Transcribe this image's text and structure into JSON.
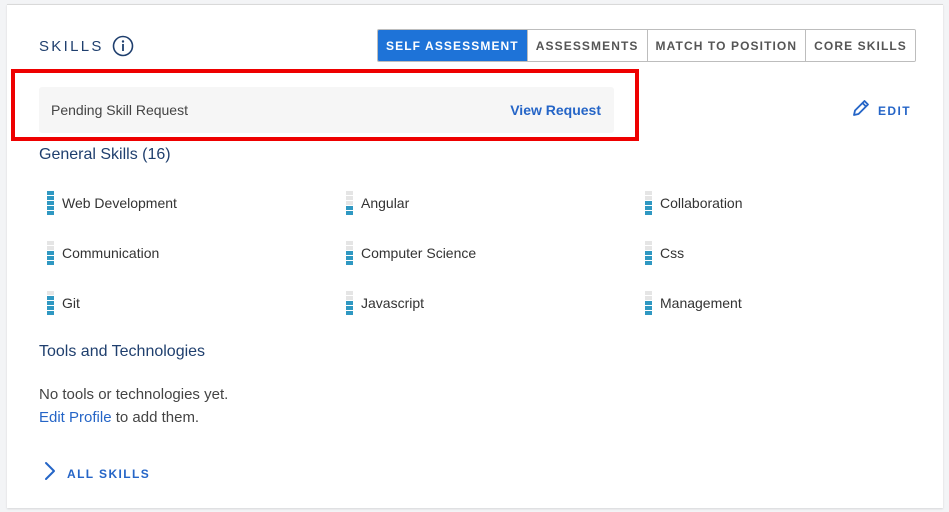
{
  "header": {
    "title": "SKILLS",
    "tabs": [
      {
        "label": "SELF ASSESSMENT",
        "active": true
      },
      {
        "label": "ASSESSMENTS",
        "active": false
      },
      {
        "label": "MATCH TO POSITION",
        "active": false
      },
      {
        "label": "CORE SKILLS",
        "active": false
      }
    ],
    "edit_label": "EDIT"
  },
  "pending": {
    "label": "Pending Skill Request",
    "link": "View Request"
  },
  "general": {
    "heading": "General Skills (16)",
    "skills": [
      {
        "name": "Web Development",
        "level": 5
      },
      {
        "name": "Angular",
        "level": 2
      },
      {
        "name": "Collaboration",
        "level": 3
      },
      {
        "name": "Communication",
        "level": 3
      },
      {
        "name": "Computer Science",
        "level": 3
      },
      {
        "name": "Css",
        "level": 3
      },
      {
        "name": "Git",
        "level": 4
      },
      {
        "name": "Javascript",
        "level": 3
      },
      {
        "name": "Management",
        "level": 3
      }
    ]
  },
  "tools": {
    "heading": "Tools and Technologies",
    "empty_line1": "No tools or technologies yet.",
    "edit_profile_link": "Edit Profile",
    "empty_line2_suffix": " to add them."
  },
  "footer": {
    "all_skills_label": "ALL SKILLS"
  },
  "colors": {
    "accent": "#1e73d8",
    "link": "#2565c7",
    "skill_bar": "#2f98c2",
    "highlight": "#ee0000"
  }
}
